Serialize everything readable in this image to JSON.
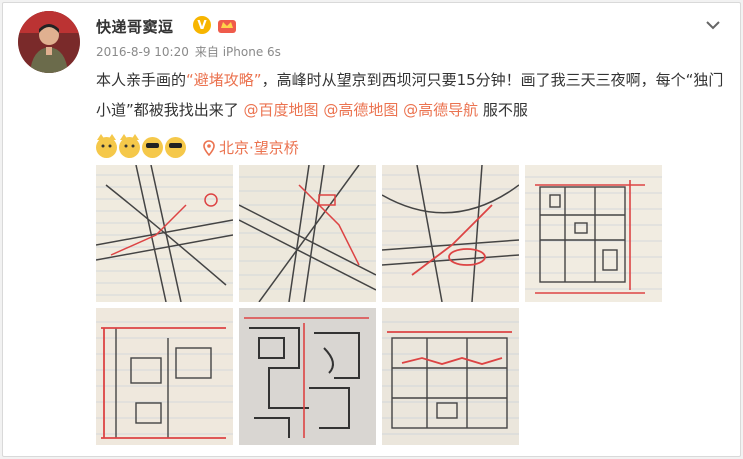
{
  "post": {
    "username": "快递哥窦逗",
    "verified_badge": "V",
    "timestamp": "2016-8-9 10:20",
    "source": "来自 iPhone 6s",
    "text": {
      "part1": "本人亲手画的",
      "highlight": "“避堵攻略”",
      "part2": "，高峰时从望京到西坝河只要15分钟！画了我三天三夜啊，每个“独门小道”都被我找出来了 ",
      "mention1": "@百度地图",
      "mention2": "@高德地图",
      "mention3": "@高德导航",
      "part3": " 服不服"
    },
    "location": "北京·望京桥",
    "icons": {
      "menu": "chevron-down-icon",
      "location": "location-pin-icon",
      "level": "level-crown-icon"
    },
    "colors": {
      "accent": "#eb7350",
      "badge": "#f7b500"
    },
    "photos": [
      {
        "label": "hand-drawn map 1"
      },
      {
        "label": "hand-drawn map 2"
      },
      {
        "label": "hand-drawn map 3"
      },
      {
        "label": "hand-drawn map 4"
      },
      {
        "label": "hand-drawn map 5"
      },
      {
        "label": "hand-drawn map 6"
      },
      {
        "label": "hand-drawn map 7"
      }
    ]
  }
}
